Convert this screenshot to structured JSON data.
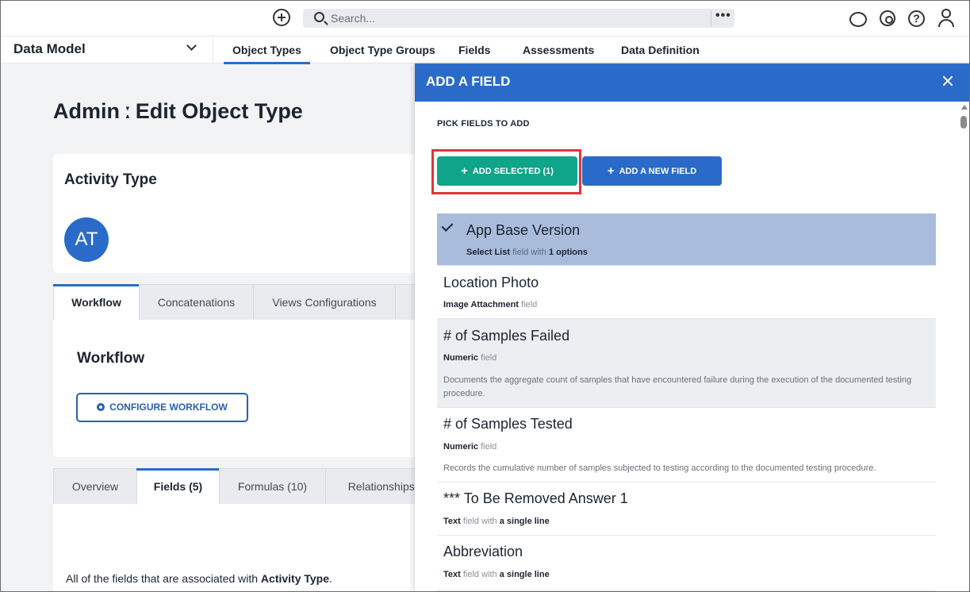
{
  "topbar": {
    "search_placeholder": "Search...",
    "more_label": "•••",
    "icons": [
      "add-circle-icon",
      "search-icon",
      "chat-icon",
      "gear-icon",
      "help-icon",
      "user-icon"
    ],
    "help_glyph": "?"
  },
  "nav": {
    "model_label": "Data Model",
    "tabs": [
      {
        "label": "Object Types"
      },
      {
        "label": "Object Type Groups"
      },
      {
        "label": "Fields"
      },
      {
        "label": "Assessments"
      },
      {
        "label": "Data Definition"
      }
    ],
    "active_tab": "Object Types"
  },
  "main": {
    "page_title": "Admin ː Edit Object Type",
    "object_name": "Activity Type",
    "avatar_initials": "AT",
    "tabs1": [
      "Workflow",
      "Concatenations",
      "Views Configurations"
    ],
    "workflow_title": "Workflow",
    "configure_button": "CONFIGURE WORKFLOW",
    "tabs2": [
      "Overview",
      "Fields (5)",
      "Formulas (10)",
      "Relationships ("
    ],
    "fields_desc_prefix": "All of the fields that are associated with ",
    "fields_desc_object": "Activity Type",
    "fields_desc_suffix": "."
  },
  "drawer": {
    "title": "ADD A FIELD",
    "pick_label": "PICK FIELDS TO ADD",
    "add_selected": "ADD SELECTED (1)",
    "add_new": "ADD A NEW FIELD",
    "items": [
      {
        "name": "App Base Version",
        "type": "Select List",
        "mid": " field with ",
        "extra": "1 options",
        "desc": "",
        "selected": true
      },
      {
        "name": "Location Photo",
        "type": "Image Attachment",
        "mid": " field",
        "extra": "",
        "desc": "",
        "selected": false
      },
      {
        "name": "# of Samples Failed",
        "type": "Numeric",
        "mid": " field",
        "extra": "",
        "desc": "Documents the aggregate count of samples that have encountered failure during the execution of the documented testing procedure.",
        "selected": false
      },
      {
        "name": "# of Samples Tested",
        "type": "Numeric",
        "mid": " field",
        "extra": "",
        "desc": "Records the cumulative number of samples subjected to testing according to the documented testing procedure.",
        "selected": false
      },
      {
        "name": "*** To Be Removed Answer 1",
        "type": "Text",
        "mid": " field with ",
        "extra": "a single line",
        "desc": "",
        "selected": false
      },
      {
        "name": "Abbreviation",
        "type": "Text",
        "mid": " field with ",
        "extra": "a single line",
        "desc": "",
        "selected": false
      }
    ]
  },
  "colors": {
    "primary": "#2a6bc9",
    "success": "#0ea58a",
    "selected_row": "#a9bcdc",
    "highlight": "#e3343a"
  }
}
